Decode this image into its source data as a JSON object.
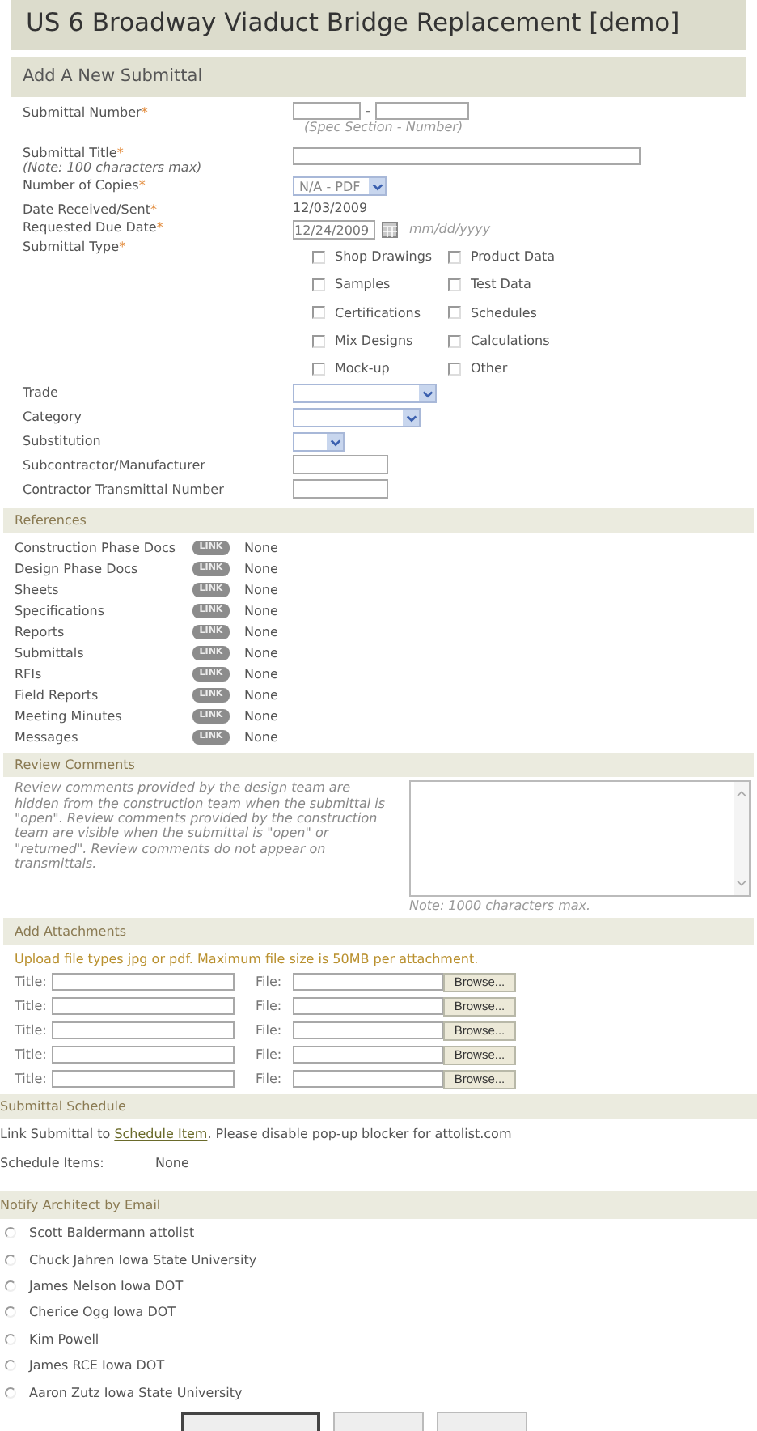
{
  "page_title": "US 6 Broadway Viaduct Bridge Replacement [demo]",
  "submittal_form": {
    "heading": "Add A New Submittal",
    "rows": [
      {
        "kind": "number",
        "label": "Submittal Number",
        "required_mark": "*",
        "separator": "-",
        "hint": "(Spec Section - Number)"
      },
      {
        "kind": "text",
        "label": "Submittal Title",
        "required_mark": "*",
        "note": "(Note: 100 characters max)"
      },
      {
        "kind": "select",
        "label": "Number of Copies",
        "required_mark": "*",
        "value": "N/A - PDF"
      },
      {
        "kind": "static",
        "label": "Date Received/Sent",
        "required_mark": "*",
        "value": "12/03/2009"
      },
      {
        "kind": "date",
        "label": "Requested Due Date",
        "required_mark": "*",
        "value": "12/24/2009",
        "hint": "mm/dd/yyyy"
      },
      {
        "kind": "checkboxes",
        "label": "Submittal Type",
        "required_mark": "*",
        "options": [
          {
            "label": "Shop Drawings",
            "checked": false
          },
          {
            "label": "Product Data",
            "checked": false
          },
          {
            "label": "Samples",
            "checked": false
          },
          {
            "label": "Test Data",
            "checked": false
          },
          {
            "label": "Certifications",
            "checked": false
          },
          {
            "label": "Schedules",
            "checked": false
          },
          {
            "label": "Mix Designs",
            "checked": false
          },
          {
            "label": "Calculations",
            "checked": false
          },
          {
            "label": "Mock-up",
            "checked": false
          },
          {
            "label": "Other",
            "checked": false
          }
        ]
      },
      {
        "kind": "select",
        "label": "Trade"
      },
      {
        "kind": "select",
        "label": "Category"
      },
      {
        "kind": "select",
        "label": "Substitution"
      },
      {
        "kind": "text",
        "label": "Subcontractor/Manufacturer"
      },
      {
        "kind": "text",
        "label": "Contractor Transmittal Number"
      }
    ]
  },
  "references": {
    "heading": "References",
    "items": [
      {
        "label": "Construction Phase Docs",
        "link": "LINK",
        "value": "None"
      },
      {
        "label": "Design Phase Docs",
        "link": "LINK",
        "value": "None"
      },
      {
        "label": "Sheets",
        "link": "LINK",
        "value": "None"
      },
      {
        "label": "Specifications",
        "link": "LINK",
        "value": "None"
      },
      {
        "label": "Reports",
        "link": "LINK",
        "value": "None"
      },
      {
        "label": "Submittals",
        "link": "LINK",
        "value": "None"
      },
      {
        "label": "RFIs",
        "link": "LINK",
        "value": "None"
      },
      {
        "label": "Field Reports",
        "link": "LINK",
        "value": "None"
      },
      {
        "label": "Meeting Minutes",
        "link": "LINK",
        "value": "None"
      },
      {
        "label": "Messages",
        "link": "LINK",
        "value": "None"
      }
    ]
  },
  "review_comments": {
    "heading": "Review Comments",
    "description": "Review comments provided by the design team are hidden from the construction team when the submittal is \"open\". Review comments provided by the construction team are visible when the submittal is \"open\" or \"returned\". Review comments do not appear on transmittals.",
    "note": "Note: 1000 characters max."
  },
  "attachments": {
    "heading": "Add Attachments",
    "instructions": "Upload file types jpg or pdf. Maximum file size is 50MB per attachment.",
    "rows": [
      {
        "title_label": "Title:",
        "file_label": "File:",
        "browse": "Browse..."
      },
      {
        "title_label": "Title:",
        "file_label": "File:",
        "browse": "Browse..."
      },
      {
        "title_label": "Title:",
        "file_label": "File:",
        "browse": "Browse..."
      },
      {
        "title_label": "Title:",
        "file_label": "File:",
        "browse": "Browse..."
      },
      {
        "title_label": "Title:",
        "file_label": "File:",
        "browse": "Browse..."
      }
    ]
  },
  "schedule": {
    "heading": "Submittal Schedule",
    "text_before": "Link Submittal to ",
    "link": "Schedule Item",
    "text_after": ". Please disable pop-up blocker for attolist.com",
    "items_label": "Schedule Items:",
    "items_value": "None"
  },
  "notify": {
    "heading": "Notify Architect by Email",
    "recipients": [
      {
        "name": "Scott Baldermann attolist",
        "selected": false
      },
      {
        "name": "Chuck Jahren Iowa State University",
        "selected": false
      },
      {
        "name": "James Nelson Iowa DOT",
        "selected": false
      },
      {
        "name": "Cherice Ogg Iowa DOT",
        "selected": false
      },
      {
        "name": "Kim Powell",
        "selected": false
      },
      {
        "name": "James RCE Iowa DOT",
        "selected": false
      },
      {
        "name": "Aaron Zutz Iowa State University",
        "selected": false
      }
    ]
  },
  "action_buttons": [
    {
      "kind": "default"
    },
    {
      "kind": "plain"
    },
    {
      "kind": "plain"
    }
  ]
}
